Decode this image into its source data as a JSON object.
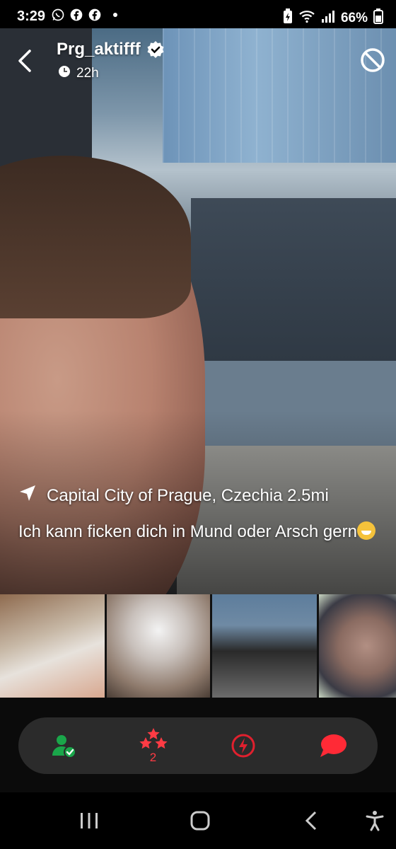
{
  "status_bar": {
    "time": "3:29",
    "battery": "66%",
    "left_icons": [
      "whatsapp-icon",
      "facebook-icon",
      "facebook-icon",
      "notification-dot"
    ],
    "right_icons": [
      "battery-saver-icon",
      "wifi-icon",
      "signal-icon",
      "battery-icon"
    ]
  },
  "header": {
    "username": "Prg_aktifff",
    "last_seen": "22h",
    "verified": true
  },
  "profile": {
    "location": "Capital City of Prague, Czechia 2.5mi",
    "caption": "Ich kann ficken dich in Mund oder Arsch gern"
  },
  "thumbnails": [
    {
      "name": "photo-thumb-1"
    },
    {
      "name": "photo-thumb-2"
    },
    {
      "name": "photo-thumb-3"
    },
    {
      "name": "photo-thumb-4"
    }
  ],
  "actions": {
    "favorite_count": "2",
    "colors": {
      "favorite": "#ff3b44",
      "accent": "#e0202e",
      "added": "#1aa64a"
    }
  },
  "nav": {
    "icons": [
      "recent-apps-icon",
      "home-icon",
      "back-icon",
      "accessibility-icon"
    ]
  }
}
